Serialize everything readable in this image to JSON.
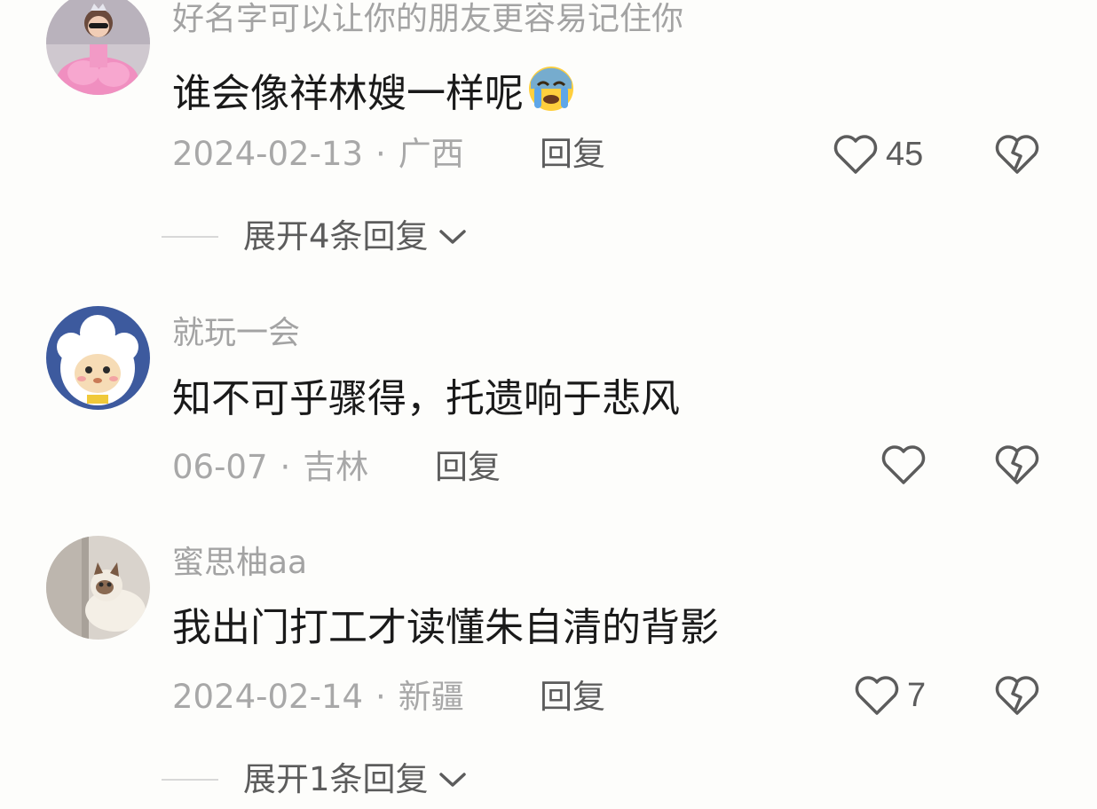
{
  "comments": [
    {
      "username": "好名字可以让你的朋友更容易记住你",
      "text": "谁会像祥林嫂一样呢",
      "emoji": "loudly-crying-face",
      "date": "2024-02-13",
      "separator": "·",
      "location": "广西",
      "reply_label": "回复",
      "like_count": "45",
      "expand_label": "展开4条回复"
    },
    {
      "username": "就玩一会",
      "text": "知不可乎骤得，托遗响于悲风",
      "date": "06-07",
      "separator": "·",
      "location": "吉林",
      "reply_label": "回复",
      "like_count": ""
    },
    {
      "username": "蜜思柚aa",
      "text": "我出门打工才读懂朱自清的背影",
      "date": "2024-02-14",
      "separator": "·",
      "location": "新疆",
      "reply_label": "回复",
      "like_count": "7",
      "expand_label": "展开1条回复"
    }
  ],
  "icons": {
    "like": "heart-outline-icon",
    "dislike": "broken-heart-icon",
    "expand": "chevron-down-icon"
  },
  "colors": {
    "background": "#fdfdfb",
    "text_primary": "#1a1a1a",
    "text_secondary": "#a3a3a3",
    "text_action": "#5c5c5c"
  }
}
